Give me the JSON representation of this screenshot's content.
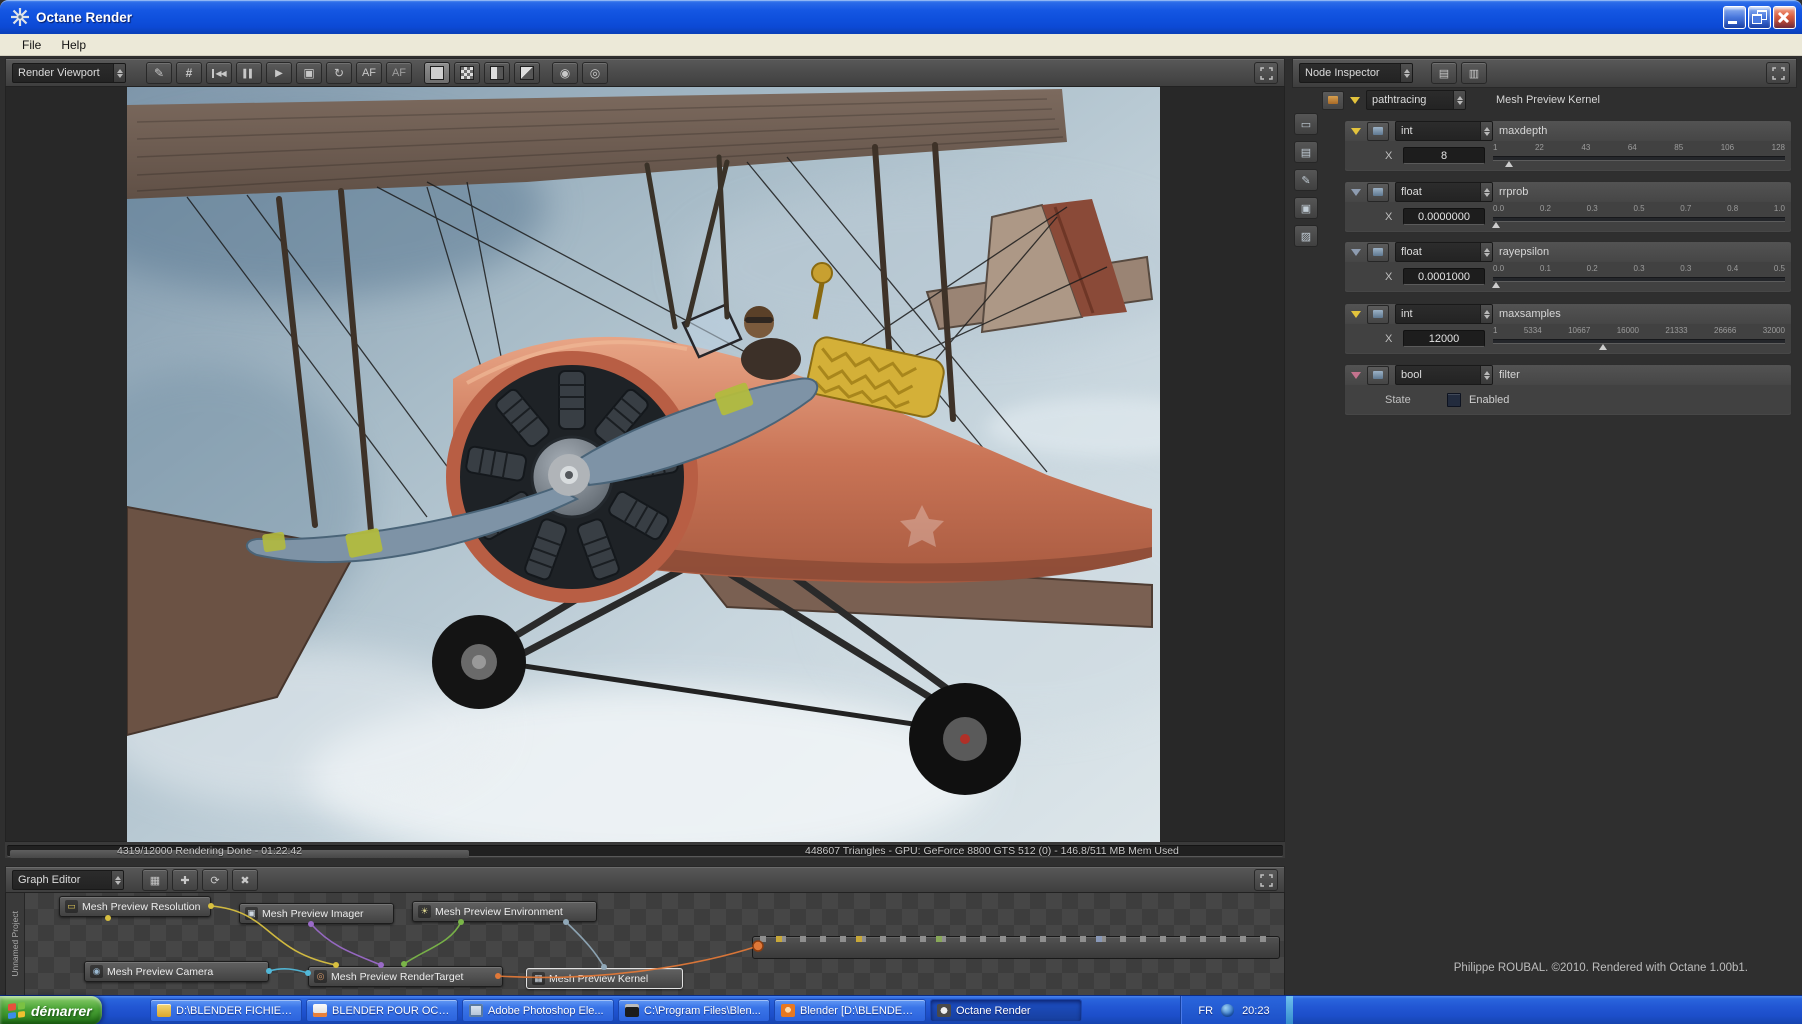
{
  "window": {
    "title": "Octane Render",
    "menu": [
      {
        "label": "File"
      },
      {
        "label": "Help"
      }
    ]
  },
  "viewport": {
    "panel_selector": "Render Viewport",
    "af_button": "AF",
    "af2_button": "AF",
    "status_progress_text": "4319/12000 Rendering Done - 01:22:42",
    "status_stats_text": "448607 Triangles - GPU: GeForce 8800 GTS 512 (0) - 146.8/511 MB Mem Used"
  },
  "graph_editor": {
    "panel_selector": "Graph Editor",
    "project_tab": "Unnamed Project",
    "nodes": [
      {
        "label": "Mesh Preview Resolution",
        "icon_glyph": "▭"
      },
      {
        "label": "Mesh Preview Imager",
        "icon_glyph": "▣"
      },
      {
        "label": "Mesh Preview Environment",
        "icon_glyph": "☀"
      },
      {
        "label": "Mesh Preview Camera",
        "icon_glyph": "◉"
      },
      {
        "label": "Mesh Preview RenderTarget",
        "icon_glyph": "◎"
      },
      {
        "label": "Mesh Preview Kernel",
        "icon_glyph": "▦"
      }
    ]
  },
  "node_inspector": {
    "panel_selector": "Node Inspector",
    "node_type": "pathtracing",
    "node_name": "Mesh Preview Kernel",
    "params": [
      {
        "type": "int",
        "name": "maxdepth",
        "axis": "X",
        "value": "8",
        "ticks": [
          "1",
          "22",
          "43",
          "64",
          "85",
          "106",
          "128"
        ]
      },
      {
        "type": "float",
        "name": "rrprob",
        "axis": "X",
        "value": "0.0000000",
        "ticks": [
          "0.0",
          "0.2",
          "0.3",
          "0.5",
          "0.7",
          "0.8",
          "1.0"
        ]
      },
      {
        "type": "float",
        "name": "rayepsilon",
        "axis": "X",
        "value": "0.0001000",
        "ticks": [
          "0.0",
          "0.1",
          "0.2",
          "0.3",
          "0.3",
          "0.4",
          "0.5"
        ]
      },
      {
        "type": "int",
        "name": "maxsamples",
        "axis": "X",
        "value": "12000",
        "ticks": [
          "1",
          "5334",
          "10667",
          "16000",
          "21333",
          "26666",
          "32000"
        ]
      },
      {
        "type": "bool",
        "name": "filter",
        "state_label": "State",
        "value_label": "Enabled"
      }
    ],
    "credit": "Philippe ROUBAL. ©2010. Rendered with Octane 1.00b1."
  },
  "taskbar": {
    "start_label": "démarrer",
    "items": [
      {
        "label": "D:\\BLENDER FICHIER..."
      },
      {
        "label": "BLENDER POUR OCT..."
      },
      {
        "label": "Adobe Photoshop Ele..."
      },
      {
        "label": "C:\\Program Files\\Blen..."
      },
      {
        "label": "Blender [D:\\BLENDER..."
      },
      {
        "label": "Octane Render"
      }
    ],
    "tray": {
      "language": "FR",
      "time": "20:23"
    }
  },
  "icons": {
    "pick": "✎",
    "grid": "#",
    "skip_start": "◀◀",
    "pause": "▌▌",
    "play": "▶",
    "frame": "▣",
    "refresh": "↻",
    "sphere1": "◉",
    "sphere2": "◎",
    "inspector_tool1": "▤",
    "inspector_tool2": "▥",
    "strip": [
      "▭",
      "▤",
      "✎",
      "▣",
      "▨"
    ],
    "graph_tools": [
      "▦",
      "✚",
      "⟳",
      "✖"
    ]
  },
  "colors": {
    "titlebar_blue": "#1557e3",
    "taskbar_blue": "#2257d4",
    "start_green": "#4aa336",
    "ui_dark": "#3f3f3f",
    "accent_yellow": "#e3c33c",
    "marker_blue": "#8e9cb0",
    "marker_pink": "#c4738e",
    "wire_yellow": "#d8c040",
    "wire_green": "#7ab648",
    "wire_cyan": "#52b8d8",
    "wire_purple": "#9a6ac8",
    "wire_orange": "#e07838"
  }
}
